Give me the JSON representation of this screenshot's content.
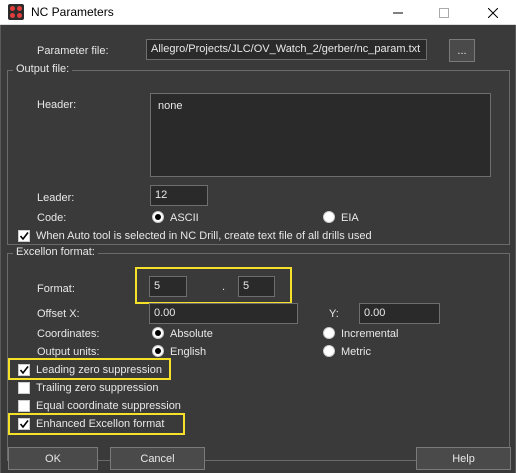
{
  "window": {
    "title": "NC Parameters"
  },
  "parameter_file": {
    "label": "Parameter file:",
    "value": "Allegro/Projects/JLC/OV_Watch_2/gerber/nc_param.txt",
    "browse_label": "..."
  },
  "output_file": {
    "group_title": "Output file:",
    "header_label": "Header:",
    "header_value": "none",
    "leader_label": "Leader:",
    "leader_value": "12",
    "code_label": "Code:",
    "code_options": [
      "ASCII",
      "EIA"
    ],
    "code_selected": "ASCII",
    "auto_tool_label": "When Auto tool is selected in NC Drill, create text file of all drills used",
    "auto_tool_checked": true
  },
  "excellon": {
    "group_title": "Excellon format:",
    "format_label": "Format:",
    "format_int": "5",
    "format_sep": ".",
    "format_dec": "5",
    "offset_x_label": "Offset X:",
    "offset_x_value": "0.00",
    "offset_y_label": "Y:",
    "offset_y_value": "0.00",
    "coordinates_label": "Coordinates:",
    "coordinates_options": [
      "Absolute",
      "Incremental"
    ],
    "coordinates_selected": "Absolute",
    "units_label": "Output units:",
    "units_options": [
      "English",
      "Metric"
    ],
    "units_selected": "English",
    "leading_zero_label": "Leading zero suppression",
    "leading_zero_checked": true,
    "trailing_zero_label": "Trailing zero suppression",
    "trailing_zero_checked": false,
    "equal_coord_label": "Equal coordinate suppression",
    "equal_coord_checked": false,
    "enhanced_label": "Enhanced Excellon format",
    "enhanced_checked": true
  },
  "buttons": {
    "ok": "OK",
    "cancel": "Cancel",
    "help": "Help"
  },
  "colors": {
    "background": "#3a3a3a",
    "highlight": "#f5e12a",
    "titlebar": "#ffffff"
  }
}
